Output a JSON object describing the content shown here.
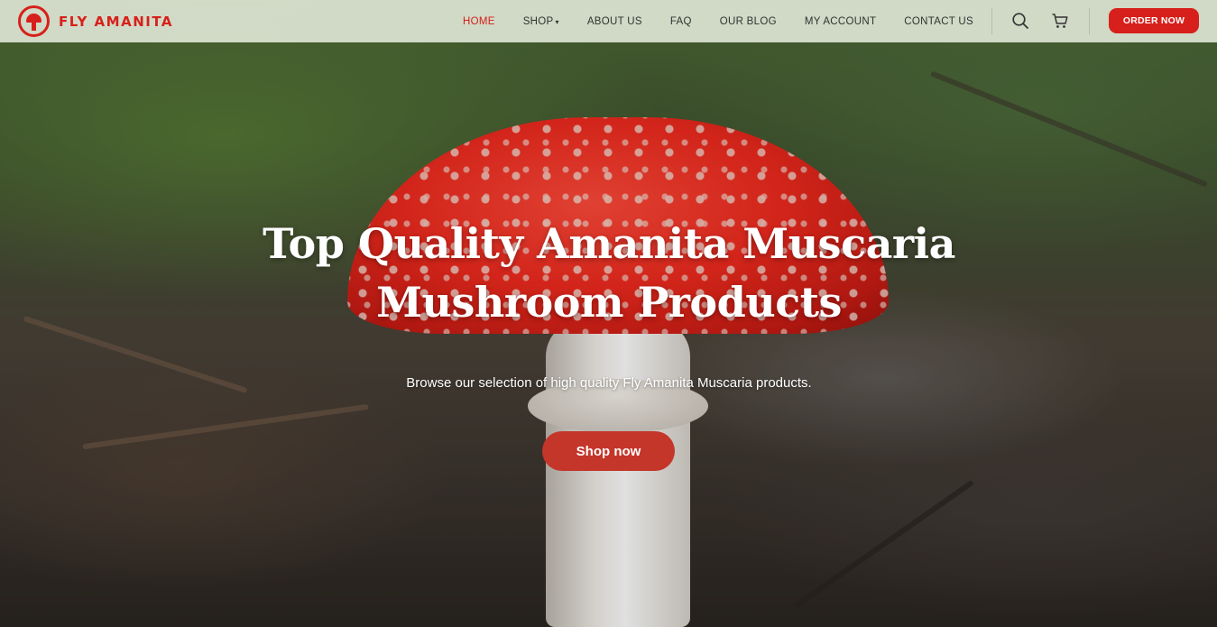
{
  "brand": {
    "name": "FLY AMANITA"
  },
  "nav": {
    "items": [
      {
        "label": "HOME",
        "active": true
      },
      {
        "label": "SHOP",
        "has_dropdown": true
      },
      {
        "label": "ABOUT US"
      },
      {
        "label": "FAQ"
      },
      {
        "label": "OUR BLOG"
      },
      {
        "label": "MY ACCOUNT"
      },
      {
        "label": "CONTACT US"
      }
    ],
    "icons": [
      "search-icon",
      "cart-icon"
    ],
    "order_button": "ORDER NOW"
  },
  "hero": {
    "title_line1": "Top Quality Amanita Muscaria",
    "title_line2": "Mushroom Products",
    "subtitle": "Browse our selection of high quality Fly Amanita Muscaria products.",
    "cta": "Shop now"
  },
  "colors": {
    "brand_red": "#d7201b",
    "active_nav": "#d7201b",
    "cta_button": "#c4352a",
    "header_bg": "#dce4d2"
  }
}
